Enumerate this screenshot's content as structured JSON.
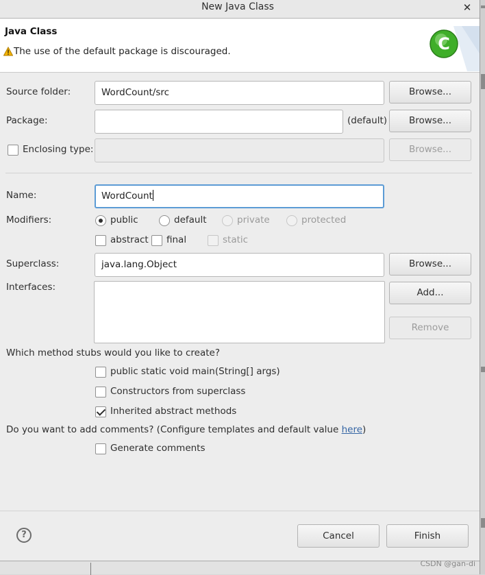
{
  "window": {
    "title": "New Java Class",
    "close_glyph": "✕"
  },
  "header": {
    "title": "Java Class",
    "warning": "The use of the default package is discouraged.",
    "warning_icon": "warning-icon",
    "logo_icon": "new-class-icon",
    "logo_letter": "C"
  },
  "form": {
    "source_folder": {
      "label": "Source folder:",
      "value": "WordCount/src",
      "browse": "Browse..."
    },
    "package": {
      "label": "Package:",
      "value": "",
      "hint": "(default)",
      "browse": "Browse..."
    },
    "enclosing_type": {
      "label": "Enclosing type:",
      "checked": false,
      "value": "",
      "browse": "Browse..."
    },
    "name": {
      "label": "Name:",
      "value": "WordCount"
    },
    "modifiers": {
      "label": "Modifiers:",
      "access": [
        {
          "label": "public",
          "selected": true,
          "enabled": true
        },
        {
          "label": "default",
          "selected": false,
          "enabled": true
        },
        {
          "label": "private",
          "selected": false,
          "enabled": false
        },
        {
          "label": "protected",
          "selected": false,
          "enabled": false
        }
      ],
      "flags": [
        {
          "label": "abstract",
          "checked": false,
          "enabled": true
        },
        {
          "label": "final",
          "checked": false,
          "enabled": true
        },
        {
          "label": "static",
          "checked": false,
          "enabled": false
        }
      ]
    },
    "superclass": {
      "label": "Superclass:",
      "value": "java.lang.Object",
      "browse": "Browse..."
    },
    "interfaces": {
      "label": "Interfaces:",
      "add": "Add...",
      "remove": "Remove"
    },
    "stubs": {
      "question": "Which method stubs would you like to create?",
      "options": [
        {
          "label": "public static void main(String[] args)",
          "checked": false
        },
        {
          "label": "Constructors from superclass",
          "checked": false
        },
        {
          "label": "Inherited abstract methods",
          "checked": true
        }
      ]
    },
    "comments": {
      "question_prefix": "Do you want to add comments? (Configure templates and default value ",
      "link": "here",
      "question_suffix": ")",
      "option": {
        "label": "Generate comments",
        "checked": false
      }
    }
  },
  "footer": {
    "help_glyph": "?",
    "cancel": "Cancel",
    "finish": "Finish"
  },
  "watermark": "CSDN @gan-di",
  "colors": {
    "focus_border": "#5b9bd5",
    "link": "#3465a4",
    "logo_green": "#3fae29"
  }
}
